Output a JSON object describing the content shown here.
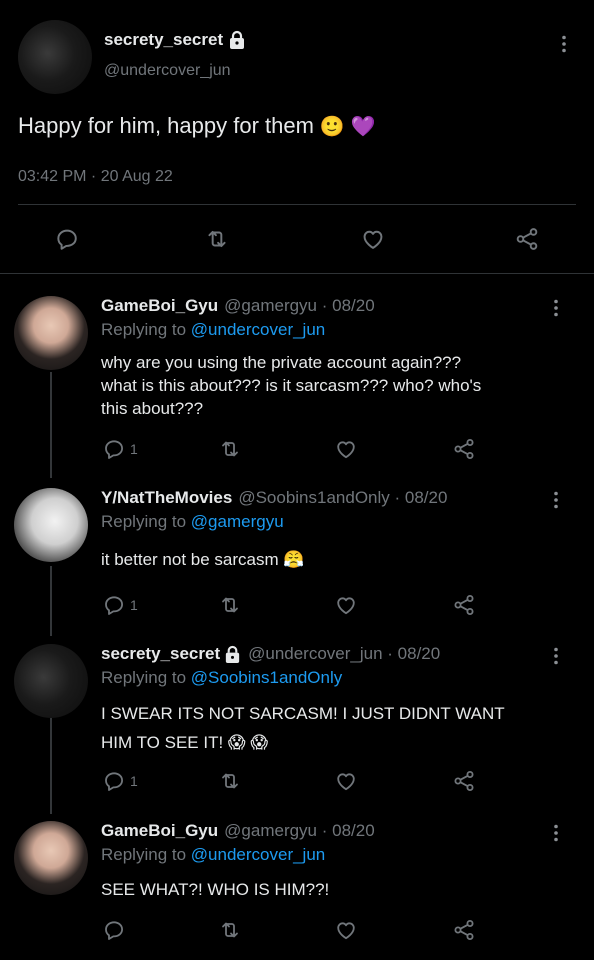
{
  "main_tweet": {
    "name": "secrety_secret",
    "handle": "@undercover_jun",
    "text": "Happy for him, happy for them",
    "emojis": [
      "🙂",
      "💜"
    ],
    "timestamp": "03:42 PM · 20 Aug 22"
  },
  "replies": [
    {
      "name": "GameBoi_Gyu",
      "meta": "@gamergyu · 08/20",
      "replying_prefix": "Replying to",
      "replying_to": "@undercover_jun",
      "lines": [
        "why are you using the private account again???",
        "what is this about??? is it sarcasm??? who? who's",
        "this about???"
      ],
      "reply_count": "1"
    },
    {
      "name": "Y/NatTheMovies",
      "meta": "@Soobins1andOnly · 08/20",
      "replying_prefix": "Replying to",
      "replying_to": "@gamergyu",
      "lines": [
        "it better not be sarcasm 😤"
      ],
      "reply_count": "1"
    },
    {
      "name": "secrety_secret",
      "meta": "@undercover_jun · 08/20",
      "replying_prefix": "Replying to",
      "replying_to": "@Soobins1andOnly",
      "lines": [
        "I SWEAR ITS NOT SARCASM! I JUST DIDNT WANT",
        "HIM TO SEE IT! 😱 😱"
      ],
      "reply_count": "1"
    },
    {
      "name": "GameBoi_Gyu",
      "meta": "@gamergyu · 08/20",
      "replying_prefix": "Replying to",
      "replying_to": "@undercover_jun",
      "lines": [
        "SEE WHAT?! WHO IS HIM??!"
      ],
      "reply_count": ""
    }
  ],
  "icons": {
    "lock": "lock-icon",
    "more": "more-vertical-icon",
    "reply": "reply-icon",
    "retweet": "retweet-icon",
    "like": "heart-icon",
    "share": "share-icon"
  },
  "colors": {
    "background": "#000000",
    "text": "#e7e9ea",
    "muted": "#71767b",
    "mention": "#1d9bf0",
    "divider": "#2f3336"
  }
}
